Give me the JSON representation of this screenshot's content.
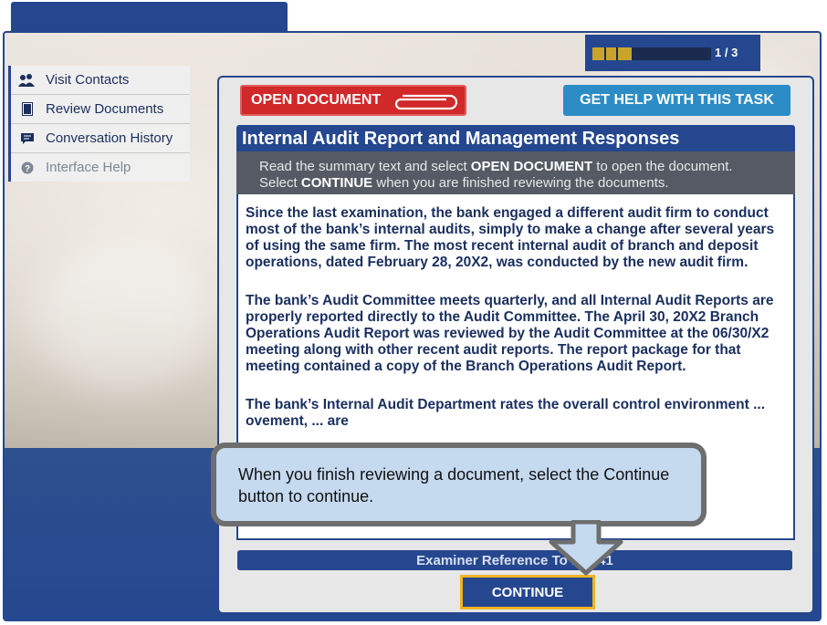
{
  "progress": {
    "current": 1,
    "total": 3,
    "label": "1  / 3",
    "fraction": 0.333
  },
  "sidebar": {
    "items": [
      {
        "label": "Visit Contacts",
        "icon": "people-icon"
      },
      {
        "label": "Review Documents",
        "icon": "document-icon"
      },
      {
        "label": "Conversation History",
        "icon": "chat-icon"
      },
      {
        "label": "Interface Help",
        "icon": "help-icon"
      }
    ]
  },
  "toolbar": {
    "open_document": "OPEN DOCUMENT",
    "get_help": "GET HELP WITH THIS TASK"
  },
  "document": {
    "title": "Internal Audit Report and Management Responses",
    "instruction": {
      "line1_prefix": "Read the summary text and select ",
      "line1_bold": "OPEN DOCUMENT",
      "line1_suffix": " to open the document.",
      "line2_prefix": "Select ",
      "line2_bold": "CONTINUE",
      "line2_suffix": " when you are finished reviewing the documents."
    },
    "paragraphs": [
      "Since the last examination, the bank engaged a different audit firm to conduct most of the bank’s internal audits, simply to make a change after several years of using the same firm. The most recent internal audit of branch and deposit operations, dated February 28, 20X2, was conducted by the new audit firm.",
      "The bank’s Audit Committee meets quarterly, and all Internal Audit Reports are properly reported directly to the Audit Committee. The April 30, 20X2 Branch Operations Audit Report was reviewed by the Audit Committee at the 06/30/X2 meeting along with other recent audit reports. The report package for that meeting contained a copy of the Branch Operations Audit Report.",
      "The bank’s Internal Audit Department rates the overall control environment ... ovement, ... are"
    ]
  },
  "reference_bar": "Examiner Reference To   ask 41",
  "continue_button": "CONTINUE",
  "callout": {
    "text": "When you finish reviewing a document, select the Continue button to continue."
  },
  "colors": {
    "brand_blue": "#25478f",
    "open_red": "#d1282a",
    "help_blue": "#2c8cc5",
    "highlight_gold": "#f0b323",
    "callout_bg": "#c5d9ef"
  }
}
